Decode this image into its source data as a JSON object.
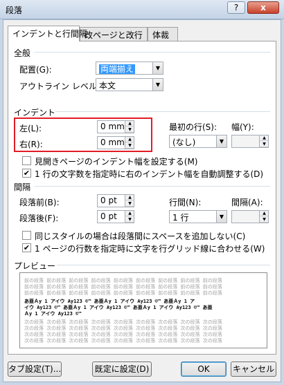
{
  "window": {
    "title": "段落",
    "help_label": "?",
    "close_label": "x"
  },
  "tabs": [
    {
      "label": "インデントと行間隔"
    },
    {
      "label": "改ページと改行"
    },
    {
      "label": "体裁"
    }
  ],
  "general": {
    "section_label": "全般",
    "alignment_label": "配置(G):",
    "alignment_value": "両端揃え",
    "outline_label": "アウトライン レベル(O):",
    "outline_value": "本文"
  },
  "indent": {
    "section_label": "インデント",
    "left_label": "左(L):",
    "left_value": "0 mm",
    "right_label": "右(R):",
    "right_value": "0 mm",
    "first_line_label": "最初の行(S):",
    "first_line_value": "(なし)",
    "width_label": "幅(Y):",
    "width_value": "",
    "mirror_label": "見開きページのインデント幅を設定する(M)",
    "mirror_checked": false,
    "auto_adjust_label": "1 行の文字数を指定時に右のインデント幅を自動調整する(D)",
    "auto_adjust_checked": true
  },
  "spacing": {
    "section_label": "間隔",
    "before_label": "段落前(B):",
    "before_value": "0 pt",
    "after_label": "段落後(F):",
    "after_value": "0 pt",
    "line_spacing_label": "行間(N):",
    "line_spacing_value": "1 行",
    "at_label": "間隔(A):",
    "at_value": "",
    "no_space_label": "同じスタイルの場合は段落間にスペースを追加しない(C)",
    "no_space_checked": false,
    "grid_label": "1 ページの行数を指定時に文字を行グリッド線に合わせる(W)",
    "grid_checked": true
  },
  "preview": {
    "section_label": "プレビュー",
    "prev_line": "前の段落 前の段落 前の段落 前の段落 前の段落 前の段落 前の段落 前の段落 前の段落",
    "sample_line1": "あ亜Ａy 1 アイウ Ay123 ©™ あ亜Ａy 1 アイウ Ay123 ©™ あ亜Ａy 1 ア",
    "sample_line2": "イウ Ay123 ©™ あ亜Ａy 1 アイウ Ay123 ©™ あ亜Ａy 1 アイウ Ay123 ©™ あ亜",
    "sample_line3": "Ａy 1 アイウ Ay123 ©™",
    "next_line": "次の段落 次の段落 次の段落 次の段落 次の段落 次の段落 次の段落 次の段落 次の段落"
  },
  "buttons": {
    "tabs": "タブ設定(T)...",
    "set_default": "既定に設定(D)",
    "ok": "OK",
    "cancel": "キャンセル"
  }
}
